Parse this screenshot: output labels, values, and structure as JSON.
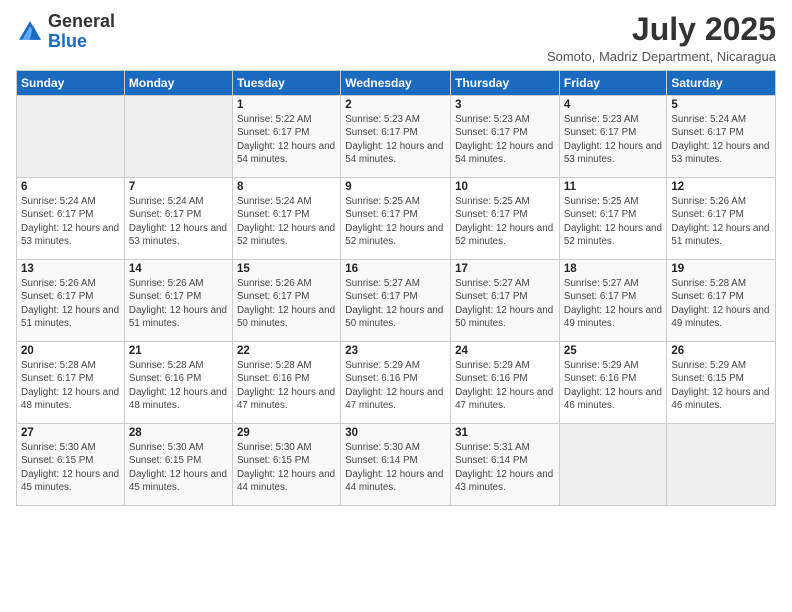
{
  "logo": {
    "general": "General",
    "blue": "Blue"
  },
  "header": {
    "monthYear": "July 2025",
    "location": "Somoto, Madriz Department, Nicaragua"
  },
  "columns": [
    "Sunday",
    "Monday",
    "Tuesday",
    "Wednesday",
    "Thursday",
    "Friday",
    "Saturday"
  ],
  "weeks": [
    [
      {
        "day": "",
        "info": ""
      },
      {
        "day": "",
        "info": ""
      },
      {
        "day": "1",
        "info": "Sunrise: 5:22 AM\nSunset: 6:17 PM\nDaylight: 12 hours and 54 minutes."
      },
      {
        "day": "2",
        "info": "Sunrise: 5:23 AM\nSunset: 6:17 PM\nDaylight: 12 hours and 54 minutes."
      },
      {
        "day": "3",
        "info": "Sunrise: 5:23 AM\nSunset: 6:17 PM\nDaylight: 12 hours and 54 minutes."
      },
      {
        "day": "4",
        "info": "Sunrise: 5:23 AM\nSunset: 6:17 PM\nDaylight: 12 hours and 53 minutes."
      },
      {
        "day": "5",
        "info": "Sunrise: 5:24 AM\nSunset: 6:17 PM\nDaylight: 12 hours and 53 minutes."
      }
    ],
    [
      {
        "day": "6",
        "info": "Sunrise: 5:24 AM\nSunset: 6:17 PM\nDaylight: 12 hours and 53 minutes."
      },
      {
        "day": "7",
        "info": "Sunrise: 5:24 AM\nSunset: 6:17 PM\nDaylight: 12 hours and 53 minutes."
      },
      {
        "day": "8",
        "info": "Sunrise: 5:24 AM\nSunset: 6:17 PM\nDaylight: 12 hours and 52 minutes."
      },
      {
        "day": "9",
        "info": "Sunrise: 5:25 AM\nSunset: 6:17 PM\nDaylight: 12 hours and 52 minutes."
      },
      {
        "day": "10",
        "info": "Sunrise: 5:25 AM\nSunset: 6:17 PM\nDaylight: 12 hours and 52 minutes."
      },
      {
        "day": "11",
        "info": "Sunrise: 5:25 AM\nSunset: 6:17 PM\nDaylight: 12 hours and 52 minutes."
      },
      {
        "day": "12",
        "info": "Sunrise: 5:26 AM\nSunset: 6:17 PM\nDaylight: 12 hours and 51 minutes."
      }
    ],
    [
      {
        "day": "13",
        "info": "Sunrise: 5:26 AM\nSunset: 6:17 PM\nDaylight: 12 hours and 51 minutes."
      },
      {
        "day": "14",
        "info": "Sunrise: 5:26 AM\nSunset: 6:17 PM\nDaylight: 12 hours and 51 minutes."
      },
      {
        "day": "15",
        "info": "Sunrise: 5:26 AM\nSunset: 6:17 PM\nDaylight: 12 hours and 50 minutes."
      },
      {
        "day": "16",
        "info": "Sunrise: 5:27 AM\nSunset: 6:17 PM\nDaylight: 12 hours and 50 minutes."
      },
      {
        "day": "17",
        "info": "Sunrise: 5:27 AM\nSunset: 6:17 PM\nDaylight: 12 hours and 50 minutes."
      },
      {
        "day": "18",
        "info": "Sunrise: 5:27 AM\nSunset: 6:17 PM\nDaylight: 12 hours and 49 minutes."
      },
      {
        "day": "19",
        "info": "Sunrise: 5:28 AM\nSunset: 6:17 PM\nDaylight: 12 hours and 49 minutes."
      }
    ],
    [
      {
        "day": "20",
        "info": "Sunrise: 5:28 AM\nSunset: 6:17 PM\nDaylight: 12 hours and 48 minutes."
      },
      {
        "day": "21",
        "info": "Sunrise: 5:28 AM\nSunset: 6:16 PM\nDaylight: 12 hours and 48 minutes."
      },
      {
        "day": "22",
        "info": "Sunrise: 5:28 AM\nSunset: 6:16 PM\nDaylight: 12 hours and 47 minutes."
      },
      {
        "day": "23",
        "info": "Sunrise: 5:29 AM\nSunset: 6:16 PM\nDaylight: 12 hours and 47 minutes."
      },
      {
        "day": "24",
        "info": "Sunrise: 5:29 AM\nSunset: 6:16 PM\nDaylight: 12 hours and 47 minutes."
      },
      {
        "day": "25",
        "info": "Sunrise: 5:29 AM\nSunset: 6:16 PM\nDaylight: 12 hours and 46 minutes."
      },
      {
        "day": "26",
        "info": "Sunrise: 5:29 AM\nSunset: 6:15 PM\nDaylight: 12 hours and 46 minutes."
      }
    ],
    [
      {
        "day": "27",
        "info": "Sunrise: 5:30 AM\nSunset: 6:15 PM\nDaylight: 12 hours and 45 minutes."
      },
      {
        "day": "28",
        "info": "Sunrise: 5:30 AM\nSunset: 6:15 PM\nDaylight: 12 hours and 45 minutes."
      },
      {
        "day": "29",
        "info": "Sunrise: 5:30 AM\nSunset: 6:15 PM\nDaylight: 12 hours and 44 minutes."
      },
      {
        "day": "30",
        "info": "Sunrise: 5:30 AM\nSunset: 6:14 PM\nDaylight: 12 hours and 44 minutes."
      },
      {
        "day": "31",
        "info": "Sunrise: 5:31 AM\nSunset: 6:14 PM\nDaylight: 12 hours and 43 minutes."
      },
      {
        "day": "",
        "info": ""
      },
      {
        "day": "",
        "info": ""
      }
    ]
  ]
}
